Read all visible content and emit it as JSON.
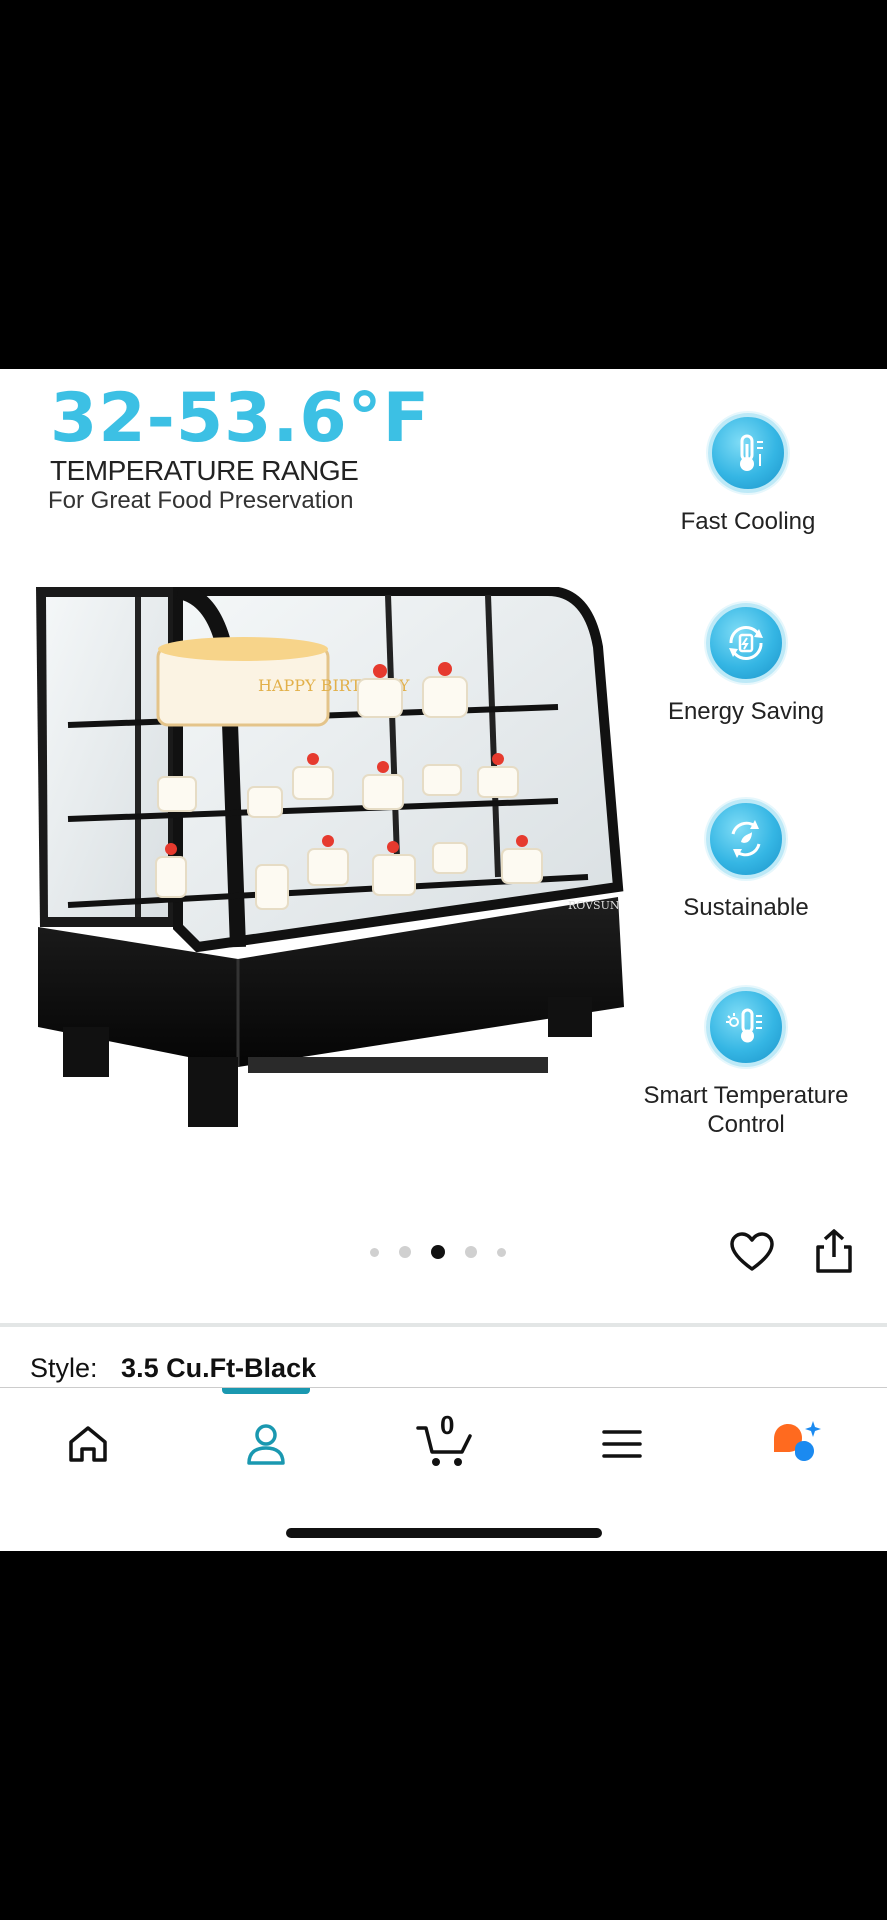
{
  "product_image": {
    "headline": "32-53.6°F",
    "subtitle": "TEMPERATURE RANGE",
    "caption": "For Great Food Preservation",
    "brand_label": "ROVSUN",
    "cake_text": "HAPPY BIRTHDAY",
    "features": [
      {
        "label": "Fast Cooling",
        "icon": "thermometer-icon"
      },
      {
        "label": "Energy Saving",
        "icon": "battery-cycle-icon"
      },
      {
        "label": "Sustainable",
        "icon": "recycle-icon"
      },
      {
        "label": "Smart Temperature Control",
        "icon": "smart-thermometer-icon"
      }
    ]
  },
  "carousel": {
    "total": 5,
    "active_index": 3
  },
  "actions": {
    "favorite_icon": "heart-icon",
    "share_icon": "share-icon"
  },
  "style": {
    "label": "Style:",
    "value": "3.5 Cu.Ft-Black"
  },
  "bottom_nav": {
    "items": [
      {
        "name": "home",
        "icon": "home-icon"
      },
      {
        "name": "account",
        "icon": "person-icon"
      },
      {
        "name": "cart",
        "icon": "cart-icon",
        "count": "0"
      },
      {
        "name": "menu",
        "icon": "menu-icon"
      },
      {
        "name": "assistant",
        "icon": "rufus-assistant-icon"
      }
    ],
    "active": "account"
  },
  "colors": {
    "accent": "#3cc0e4",
    "nav_indicator": "#1a98b0",
    "assistant_orange": "#ff6a1f",
    "assistant_blue": "#1b8af0"
  }
}
